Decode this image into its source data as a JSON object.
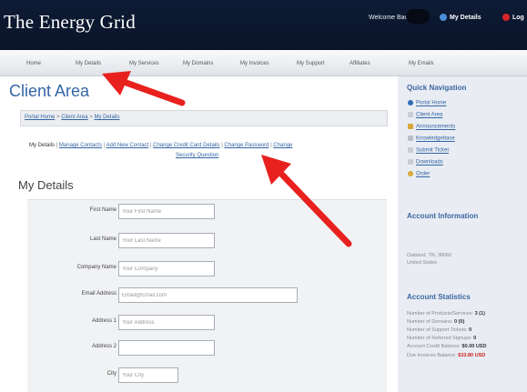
{
  "header": {
    "brand": "The Energy Grid",
    "welcome": "Welcome Back,",
    "my_details": "My Details",
    "logout": "Log"
  },
  "nav": {
    "items": [
      "Home",
      "My Details",
      "My Services",
      "My Domains",
      "My Invoices",
      "My Support",
      "Affiliates",
      "My Emails"
    ]
  },
  "main": {
    "title": "Client Area",
    "breadcrumb": [
      "Portal Home",
      "Client Area",
      "My Details"
    ],
    "subtabs": [
      "My Details",
      "Manage Contacts",
      "Add New Contact",
      "Change Credit Card Details",
      "Change Password",
      "Change",
      "Security Question"
    ],
    "section_title": "My Details",
    "form": [
      {
        "label": "First Name",
        "placeholder": "Your First Name"
      },
      {
        "label": "Last Name",
        "placeholder": "Your Last Name"
      },
      {
        "label": "Company Name",
        "placeholder": "Your Company"
      },
      {
        "label": "Email Address",
        "placeholder": "Email@Email.com"
      },
      {
        "label": "Address 1",
        "placeholder": "Your Address"
      },
      {
        "label": "Address 2",
        "placeholder": ""
      },
      {
        "label": "City",
        "placeholder": "Your City"
      }
    ]
  },
  "sidebar": {
    "quick_nav_title": "Quick Navigation",
    "quick_links": [
      "Portal Home",
      "Client Area",
      "Announcements",
      "Knowledgebase",
      "Submit Ticket",
      "Downloads",
      "Order"
    ],
    "account_info_title": "Account Information",
    "account_info_lines": [
      "Oakland, TN, 38060",
      "United States"
    ],
    "account_stats_title": "Account Statistics",
    "stats": [
      {
        "label": "Number of Products/Services:",
        "value": "3 (1)"
      },
      {
        "label": "Number of Domains:",
        "value": "0 (0)"
      },
      {
        "label": "Number of Support Tickets:",
        "value": "0"
      },
      {
        "label": "Number of Referred Signups:",
        "value": "0"
      },
      {
        "label": "Account Credit Balance:",
        "value": "$0.00 USD"
      },
      {
        "label": "Due Invoices Balance:",
        "value": "$33.80 USD"
      }
    ]
  },
  "colors": {
    "header_bg": "#0e1b35",
    "link_blue": "#3465a4",
    "arrow_red": "#e8211e",
    "sidebar_bg": "#e9edf3",
    "due_red": "#cc1f1f"
  },
  "icons": {
    "header_user": "user-icon",
    "header_logout": "power-icon",
    "arrows": "annotation-arrow"
  }
}
